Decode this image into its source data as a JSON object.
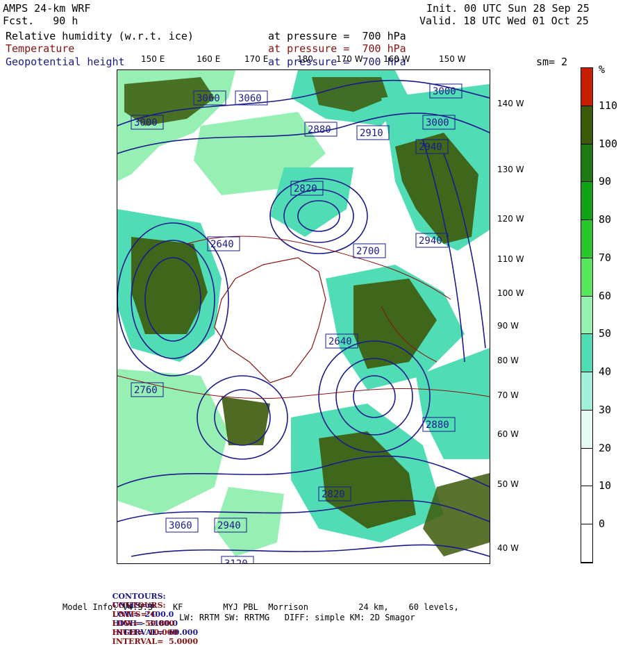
{
  "header": {
    "model": "AMPS 24-km WRF",
    "fcst": "Fcst.   90 h",
    "init": "Init. 00 UTC Sun 28 Sep 25",
    "valid": "Valid. 18 UTC Wed 01 Oct 25",
    "sm": "sm= 2"
  },
  "fields": [
    {
      "name": "Relative humidity (w.r.t. ice)",
      "level": "at pressure =  700 hPa",
      "color": "#000000"
    },
    {
      "name": "Temperature",
      "level": "at pressure =  700 hPa",
      "color": "#8b1010"
    },
    {
      "name": "Geopotential height",
      "level": "at pressure =  700 hPa",
      "color": "#1a1a8c"
    }
  ],
  "top_lon_labels": [
    "150 E",
    "160 E",
    "170 E",
    "180",
    "170 W",
    "160 W",
    "150 W"
  ],
  "right_lon_labels": [
    "140 W",
    "130 W",
    "120 W",
    "110 W",
    "100 W",
    "90 W",
    "80 W",
    "70 W",
    "60 W",
    "50 W",
    "40 W"
  ],
  "height_labels": [
    "3060",
    "3060",
    "3000",
    "2880",
    "2910",
    "3000",
    "2940",
    "2820",
    "2640",
    "2700",
    "2940",
    "3060",
    "2940",
    "2880",
    "2760",
    "2640",
    "2820",
    "3000",
    "3120"
  ],
  "colorbar": {
    "unit": "%",
    "labels": [
      "110",
      "100",
      "90",
      "80",
      "70",
      "60",
      "50",
      "40",
      "30",
      "20",
      "10",
      "0"
    ],
    "colors": [
      "#c81e00",
      "#3c5a0a",
      "#1e7814",
      "#14a014",
      "#28c828",
      "#5ae65a",
      "#96f0b4",
      "#50dcb4",
      "#a0f0dc",
      "#e6faf5",
      "#ffffff",
      "#ffffff",
      "#ffffff"
    ]
  },
  "footer": {
    "line1": {
      "prefix": "CONTOURS:",
      "units": "UNITS=m",
      "low": "LOW=  2400.0",
      "high": "HIGH=  3180.0",
      "interval": "INTERVAL=  60.000",
      "color": "#1a1a8c"
    },
    "line2": {
      "prefix": "CONTOURS:",
      "units": "UNITS=°C",
      "low": "LOW= -50.000",
      "high": "HIGH=  10.000",
      "interval": "INTERVAL=  5.0000",
      "color": "#8b1010"
    },
    "line3": "Model Info: V4.3.3    KF        MYJ PBL  Morrison          24 km,    60 levels,",
    "line4": "LW: RRTM SW: RRTMG   DIFF: simple KM: 2D Smagor"
  }
}
